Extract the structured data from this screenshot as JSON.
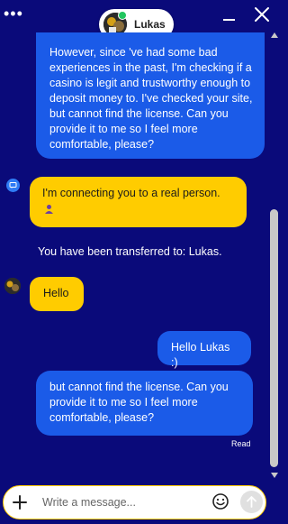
{
  "header": {
    "agent_name": "Lukas",
    "menu_dots": "•••",
    "status_color": "#22c55e"
  },
  "messages": [
    {
      "text": "However, since 've had some bad experiences in the past, I'm checking if a casino is legit and trustworthy enough to deposit money to. I've checked your site, but cannot find the license. Can you provide it to me so I feel more comfortable, please?"
    },
    {
      "text": "I'm connecting you to a real person."
    },
    {
      "text": "You have been transferred to: Lukas."
    },
    {
      "text": "Hello"
    },
    {
      "text": "Hello Lukas :)"
    },
    {
      "text": "but cannot find the license. Can you provide it to me so I feel more comfortable, please?"
    }
  ],
  "read_receipt": "Read",
  "composer": {
    "placeholder": "Write a message..."
  },
  "colors": {
    "background": "#0a0a7a",
    "user_bubble": "#1b5be8",
    "agent_bubble": "#ffcc00",
    "bot_icon": "#2f7bf5"
  },
  "icons": [
    "menu-dots-icon",
    "minimize-icon",
    "close-icon",
    "bot-icon",
    "person-icon",
    "add-icon",
    "emoji-icon",
    "send-arrow-icon"
  ]
}
